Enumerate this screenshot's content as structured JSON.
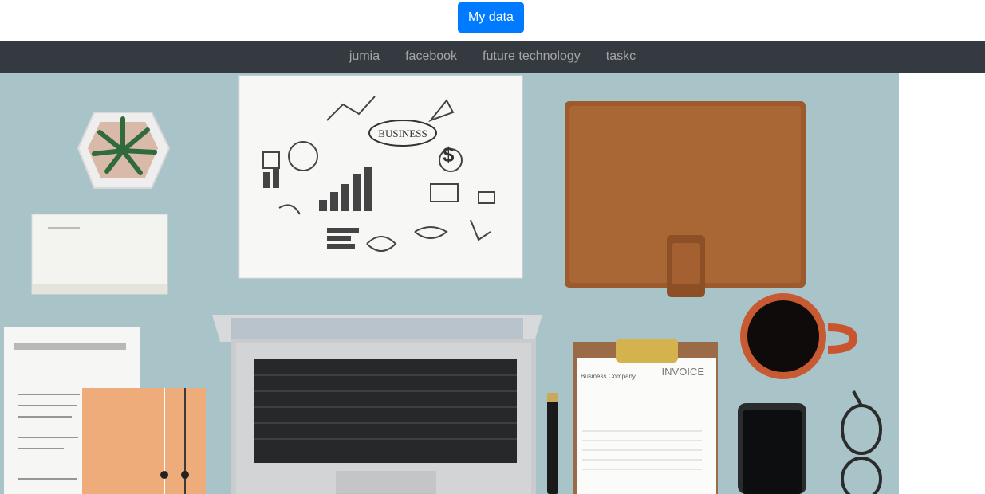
{
  "header": {
    "my_data_label": "My data"
  },
  "nav": {
    "items": [
      {
        "label": "jumia"
      },
      {
        "label": "facebook"
      },
      {
        "label": "future technology"
      },
      {
        "label": "taskc"
      }
    ]
  },
  "hero": {
    "paper_label": "BUSINESS",
    "invoice_text": "INVOICE",
    "invoice_company": "Business Company"
  }
}
